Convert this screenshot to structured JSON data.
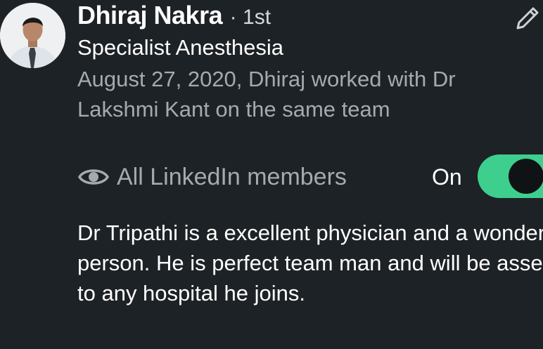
{
  "profile": {
    "name": "Dhiraj Nakra",
    "separator": "·",
    "degree": "1st",
    "headline": "Specialist Anesthesia",
    "relationship": "August 27, 2020, Dhiraj worked with Dr Lakshmi Kant on the same team"
  },
  "visibility": {
    "icon": "eye-icon",
    "label": "All LinkedIn members"
  },
  "toggle": {
    "label": "On",
    "state": "on",
    "color": "#3ecf8e"
  },
  "recommendation": {
    "text": "Dr Tripathi is a excellent physician and a wonderful person. He is perfect team man and will be asset to any hospital he joins."
  },
  "actions": {
    "edit_icon": "pencil-icon"
  },
  "colors": {
    "background": "#1d2226",
    "primary_text": "#ffffff",
    "secondary_text": "#a7aaad"
  }
}
